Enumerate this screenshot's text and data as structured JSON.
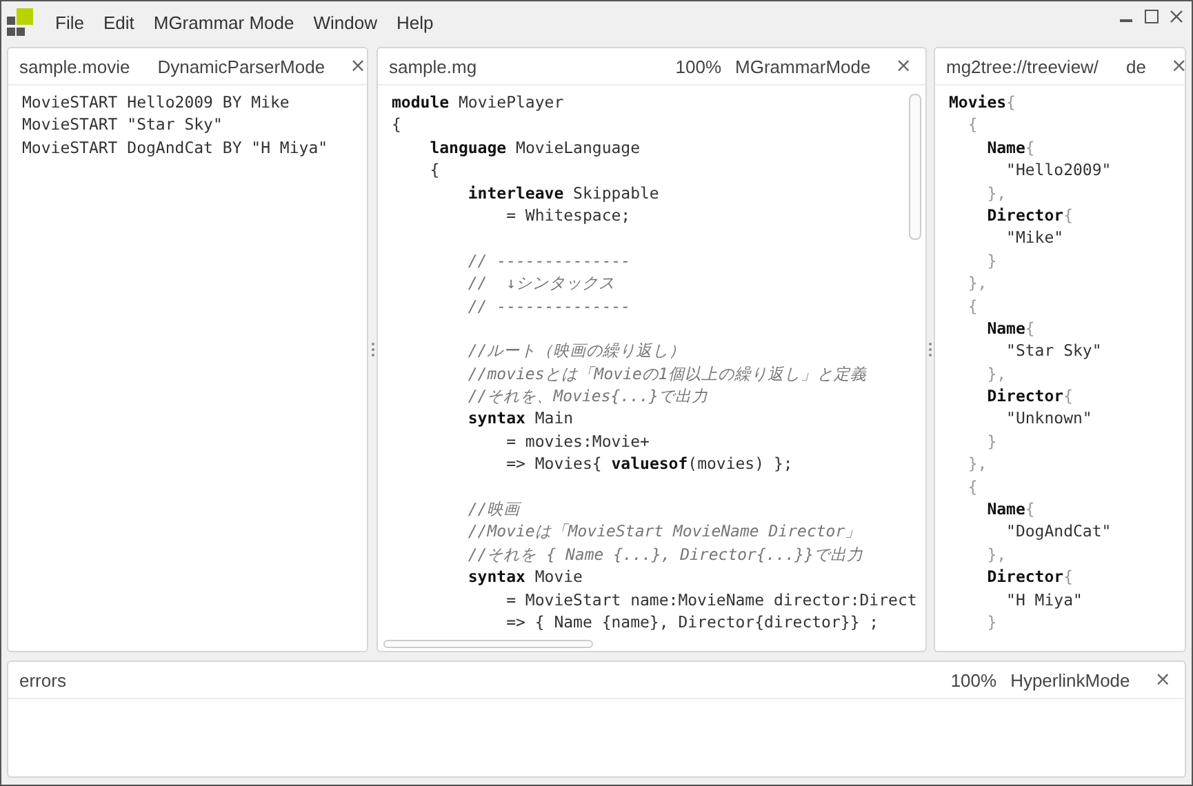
{
  "menu": [
    "File",
    "Edit",
    "MGrammar Mode",
    "Window",
    "Help"
  ],
  "panes": [
    {
      "title": "sample.movie",
      "mode": "DynamicParserMode",
      "close": "×",
      "lines": [
        {
          "kind": "code",
          "segments": [
            {
              "kind": "plain",
              "text": "MovieSTART Hello2009 BY Mike"
            }
          ]
        },
        {
          "kind": "code",
          "segments": [
            {
              "kind": "plain",
              "text": "MovieSTART \"Star Sky\""
            }
          ]
        },
        {
          "kind": "code",
          "segments": [
            {
              "kind": "plain",
              "text": "MovieSTART DogAndCat BY \"H Miya\""
            }
          ]
        }
      ]
    },
    {
      "title": "sample.mg",
      "zoom": "100%",
      "mode": "MGrammarMode",
      "close": "×",
      "lines": [
        {
          "kind": "code",
          "segments": [
            {
              "kind": "keyword",
              "text": "module"
            },
            {
              "kind": "plain",
              "text": " MoviePlayer"
            }
          ]
        },
        {
          "kind": "code",
          "segments": [
            {
              "kind": "plain",
              "text": "{"
            }
          ]
        },
        {
          "kind": "code",
          "segments": [
            {
              "kind": "keyword",
              "text": "    language"
            },
            {
              "kind": "plain",
              "text": " MovieLanguage"
            }
          ]
        },
        {
          "kind": "code",
          "segments": [
            {
              "kind": "plain",
              "text": "    {"
            }
          ]
        },
        {
          "kind": "code",
          "segments": [
            {
              "kind": "keyword",
              "text": "        interleave"
            },
            {
              "kind": "plain",
              "text": " Skippable"
            }
          ]
        },
        {
          "kind": "code",
          "segments": [
            {
              "kind": "plain",
              "text": "            = Whitespace;"
            }
          ]
        },
        {
          "kind": "blank"
        },
        {
          "kind": "code",
          "segments": [
            {
              "kind": "comment",
              "text": "        // --------------"
            }
          ]
        },
        {
          "kind": "code",
          "segments": [
            {
              "kind": "comment",
              "text": "        //  ↓シンタックス"
            }
          ]
        },
        {
          "kind": "code",
          "segments": [
            {
              "kind": "comment",
              "text": "        // --------------"
            }
          ]
        },
        {
          "kind": "blank"
        },
        {
          "kind": "code",
          "segments": [
            {
              "kind": "comment",
              "text": "        //ルート（映画の繰り返し）"
            }
          ]
        },
        {
          "kind": "code",
          "segments": [
            {
              "kind": "comment",
              "text": "        //moviesとは「Movieの1個以上の繰り返し」と定義"
            }
          ]
        },
        {
          "kind": "code",
          "segments": [
            {
              "kind": "comment",
              "text": "        //それを、Movies{...}で出力"
            }
          ]
        },
        {
          "kind": "code",
          "segments": [
            {
              "kind": "keyword",
              "text": "        syntax"
            },
            {
              "kind": "plain",
              "text": " Main"
            }
          ]
        },
        {
          "kind": "code",
          "segments": [
            {
              "kind": "plain",
              "text": "            = movies:Movie+"
            }
          ]
        },
        {
          "kind": "code",
          "segments": [
            {
              "kind": "plain",
              "text": "            => Movies{ "
            },
            {
              "kind": "keyword",
              "text": "valuesof"
            },
            {
              "kind": "plain",
              "text": "(movies) };"
            }
          ]
        },
        {
          "kind": "blank"
        },
        {
          "kind": "code",
          "segments": [
            {
              "kind": "comment",
              "text": "        //映画"
            }
          ]
        },
        {
          "kind": "code",
          "segments": [
            {
              "kind": "comment",
              "text": "        //Movieは「MovieStart MovieName Director」"
            }
          ]
        },
        {
          "kind": "code",
          "segments": [
            {
              "kind": "comment",
              "text": "        //それを { Name {...}, Director{...}}で出力"
            }
          ]
        },
        {
          "kind": "code",
          "segments": [
            {
              "kind": "keyword",
              "text": "        syntax"
            },
            {
              "kind": "plain",
              "text": " Movie"
            }
          ]
        },
        {
          "kind": "code",
          "segments": [
            {
              "kind": "plain",
              "text": "            = MovieStart name:MovieName director:Direct"
            }
          ]
        },
        {
          "kind": "code",
          "segments": [
            {
              "kind": "plain",
              "text": "            => { Name {name}, Director{director}} ;"
            }
          ]
        }
      ]
    },
    {
      "title": "mg2tree://treeview/",
      "mode": "de",
      "close": "×",
      "lines": [
        {
          "kind": "code",
          "segments": [
            {
              "kind": "keyword",
              "text": "Movies"
            },
            {
              "kind": "punct",
              "text": "{"
            }
          ]
        },
        {
          "kind": "code",
          "segments": [
            {
              "kind": "punct",
              "text": "  {"
            }
          ]
        },
        {
          "kind": "code",
          "segments": [
            {
              "kind": "keyword",
              "text": "    Name"
            },
            {
              "kind": "punct",
              "text": "{"
            }
          ]
        },
        {
          "kind": "code",
          "segments": [
            {
              "kind": "plain",
              "text": "      \"Hello2009\""
            }
          ]
        },
        {
          "kind": "code",
          "segments": [
            {
              "kind": "punct",
              "text": "    },"
            }
          ]
        },
        {
          "kind": "code",
          "segments": [
            {
              "kind": "keyword",
              "text": "    Director"
            },
            {
              "kind": "punct",
              "text": "{"
            }
          ]
        },
        {
          "kind": "code",
          "segments": [
            {
              "kind": "plain",
              "text": "      \"Mike\""
            }
          ]
        },
        {
          "kind": "code",
          "segments": [
            {
              "kind": "punct",
              "text": "    }"
            }
          ]
        },
        {
          "kind": "code",
          "segments": [
            {
              "kind": "punct",
              "text": "  },"
            }
          ]
        },
        {
          "kind": "code",
          "segments": [
            {
              "kind": "punct",
              "text": "  {"
            }
          ]
        },
        {
          "kind": "code",
          "segments": [
            {
              "kind": "keyword",
              "text": "    Name"
            },
            {
              "kind": "punct",
              "text": "{"
            }
          ]
        },
        {
          "kind": "code",
          "segments": [
            {
              "kind": "plain",
              "text": "      \"Star Sky\""
            }
          ]
        },
        {
          "kind": "code",
          "segments": [
            {
              "kind": "punct",
              "text": "    },"
            }
          ]
        },
        {
          "kind": "code",
          "segments": [
            {
              "kind": "keyword",
              "text": "    Director"
            },
            {
              "kind": "punct",
              "text": "{"
            }
          ]
        },
        {
          "kind": "code",
          "segments": [
            {
              "kind": "plain",
              "text": "      \"Unknown\""
            }
          ]
        },
        {
          "kind": "code",
          "segments": [
            {
              "kind": "punct",
              "text": "    }"
            }
          ]
        },
        {
          "kind": "code",
          "segments": [
            {
              "kind": "punct",
              "text": "  },"
            }
          ]
        },
        {
          "kind": "code",
          "segments": [
            {
              "kind": "punct",
              "text": "  {"
            }
          ]
        },
        {
          "kind": "code",
          "segments": [
            {
              "kind": "keyword",
              "text": "    Name"
            },
            {
              "kind": "punct",
              "text": "{"
            }
          ]
        },
        {
          "kind": "code",
          "segments": [
            {
              "kind": "plain",
              "text": "      \"DogAndCat\""
            }
          ]
        },
        {
          "kind": "code",
          "segments": [
            {
              "kind": "punct",
              "text": "    },"
            }
          ]
        },
        {
          "kind": "code",
          "segments": [
            {
              "kind": "keyword",
              "text": "    Director"
            },
            {
              "kind": "punct",
              "text": "{"
            }
          ]
        },
        {
          "kind": "code",
          "segments": [
            {
              "kind": "plain",
              "text": "      \"H Miya\""
            }
          ]
        },
        {
          "kind": "code",
          "segments": [
            {
              "kind": "punct",
              "text": "    }"
            }
          ]
        }
      ]
    }
  ],
  "bottom_pane": {
    "title": "errors",
    "zoom": "100%",
    "mode": "HyperlinkMode",
    "close": "×"
  }
}
